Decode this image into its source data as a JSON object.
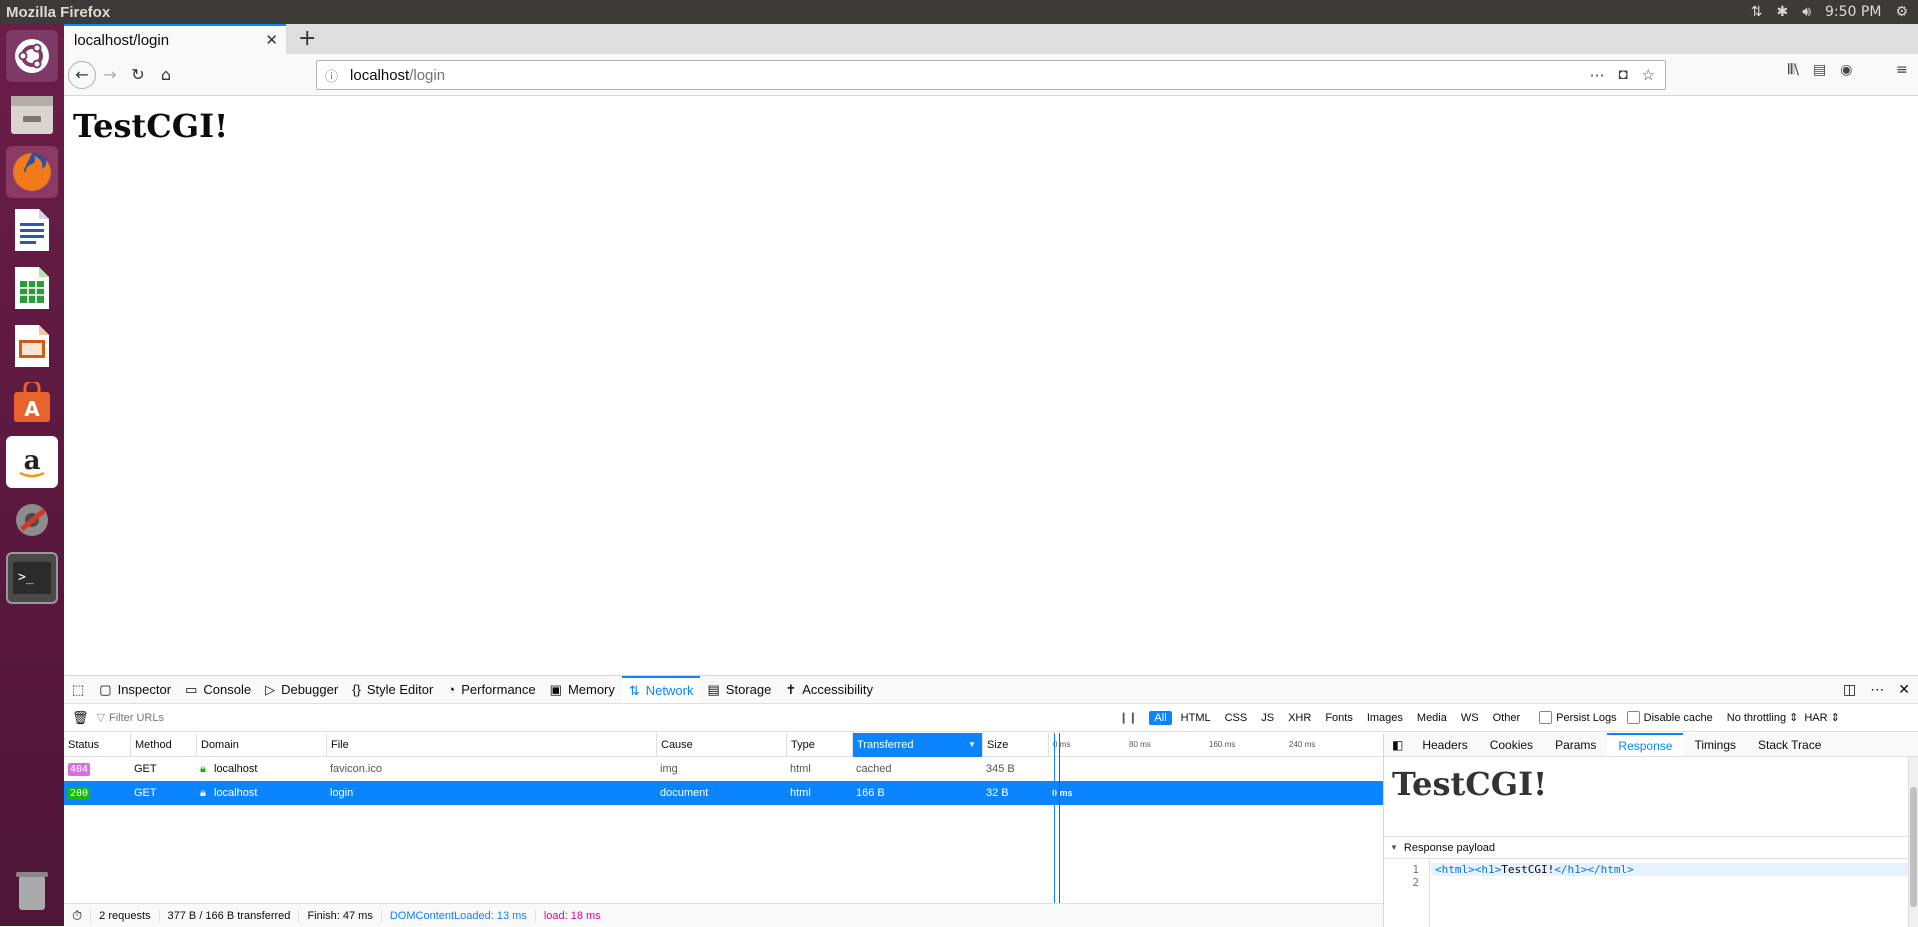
{
  "os": {
    "app_title": "Mozilla Firefox",
    "clock": "9:50 PM"
  },
  "browser": {
    "tab_title": "localhost/login",
    "url_host": "localhost",
    "url_path": "/login",
    "page_heading": "TestCGI!"
  },
  "devtools": {
    "tabs": [
      {
        "label": "Inspector",
        "icon": "inspector-icon"
      },
      {
        "label": "Console",
        "icon": "console-icon"
      },
      {
        "label": "Debugger",
        "icon": "debugger-icon"
      },
      {
        "label": "Style Editor",
        "icon": "style-editor-icon"
      },
      {
        "label": "Performance",
        "icon": "performance-icon"
      },
      {
        "label": "Memory",
        "icon": "memory-icon"
      },
      {
        "label": "Network",
        "icon": "network-icon"
      },
      {
        "label": "Storage",
        "icon": "storage-icon"
      },
      {
        "label": "Accessibility",
        "icon": "accessibility-icon"
      }
    ],
    "filter_placeholder": "Filter URLs",
    "type_filters": [
      "All",
      "HTML",
      "CSS",
      "JS",
      "XHR",
      "Fonts",
      "Images",
      "Media",
      "WS",
      "Other"
    ],
    "persist_logs": "Persist Logs",
    "disable_cache": "Disable cache",
    "throttling": "No throttling ⇕",
    "har": "HAR ⇕",
    "columns": [
      "Status",
      "Method",
      "Domain",
      "File",
      "Cause",
      "Type",
      "Transferred",
      "Size"
    ],
    "timeline_ticks": [
      "0 ms",
      "80 ms",
      "160 ms",
      "240 ms"
    ],
    "requests": [
      {
        "status": "404",
        "method": "GET",
        "domain": "localhost",
        "file": "favicon.ico",
        "cause": "img",
        "type": "html",
        "transferred": "cached",
        "size": "345 B",
        "time": ""
      },
      {
        "status": "200",
        "method": "GET",
        "domain": "localhost",
        "file": "login",
        "cause": "document",
        "type": "html",
        "transferred": "166 B",
        "size": "32 B",
        "time": "0 ms"
      }
    ],
    "statusbar": {
      "requests": "2 requests",
      "transferred": "377 B / 166 B transferred",
      "finish": "Finish: 47 ms",
      "dcl": "DOMContentLoaded: 13 ms",
      "load": "load: 18 ms"
    },
    "side_tabs": [
      "Headers",
      "Cookies",
      "Params",
      "Response",
      "Timings",
      "Stack Trace"
    ],
    "preview_heading": "TestCGI!",
    "payload_label": "Response payload",
    "code_lines": [
      "1",
      "2"
    ],
    "code_tag_open": "<html><h1>",
    "code_text": "TestCGI!",
    "code_tag_close": "</h1></html>"
  },
  "colors": {
    "accent": "#0a84ff",
    "status_404": "#d96ee2",
    "status_200": "#12bc00",
    "load": "#dd00a9"
  }
}
